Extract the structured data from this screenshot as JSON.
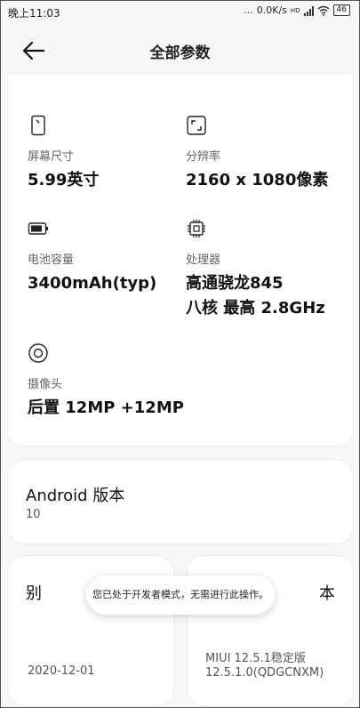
{
  "status_bar": {
    "time": "晚上11:03",
    "dots": "...",
    "net_speed": "0.0K/s",
    "network_type": "HD",
    "battery": "46",
    "icons": [
      "signal-icon",
      "wifi-icon",
      "battery-icon"
    ]
  },
  "header": {
    "title": "全部参数",
    "back_icon": "back-arrow-icon"
  },
  "specs": [
    {
      "icon": "screen-icon",
      "label": "屏幕尺寸",
      "value": "5.99英寸"
    },
    {
      "icon": "resolution-icon",
      "label": "分辨率",
      "value": "2160 x 1080像素"
    },
    {
      "icon": "battery-icon",
      "label": "电池容量",
      "value": "3400mAh(typ)"
    },
    {
      "icon": "processor-icon",
      "label": "处理器",
      "value_lines": [
        "高通骁龙845",
        "八核 最高 2.8GHz"
      ]
    },
    {
      "icon": "camera-icon",
      "label": "摄像头",
      "value": "后置 12MP +12MP"
    }
  ],
  "android": {
    "heading": "Android 版本",
    "value": "10"
  },
  "bottom_left": {
    "heading_partial": "别",
    "date": "2020-12-01"
  },
  "bottom_right": {
    "heading_partial": "本",
    "line1": "MIUI 12.5.1稳定版",
    "line2": "12.5.1.0(QDGCNXM)"
  },
  "toast": {
    "message": "您已处于开发者模式，无需进行此操作。"
  },
  "colors": {
    "background": "#f7f7f7",
    "card": "#ffffff",
    "text_primary": "#111111",
    "text_secondary": "#666666"
  }
}
